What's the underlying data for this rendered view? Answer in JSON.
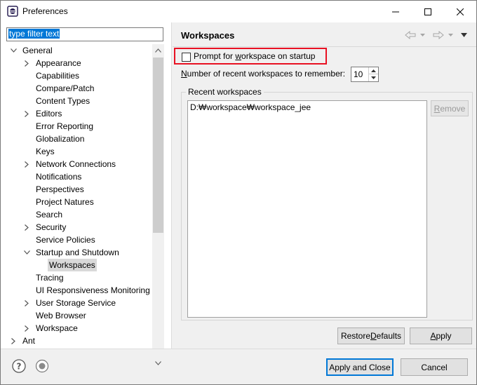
{
  "window": {
    "title": "Preferences"
  },
  "filter": {
    "value": "type filter text"
  },
  "tree": {
    "items": [
      {
        "label": "General",
        "level": 0,
        "expander": "expanded"
      },
      {
        "label": "Appearance",
        "level": 1,
        "expander": "collapsed"
      },
      {
        "label": "Capabilities",
        "level": 1,
        "expander": "none"
      },
      {
        "label": "Compare/Patch",
        "level": 1,
        "expander": "none"
      },
      {
        "label": "Content Types",
        "level": 1,
        "expander": "none"
      },
      {
        "label": "Editors",
        "level": 1,
        "expander": "collapsed"
      },
      {
        "label": "Error Reporting",
        "level": 1,
        "expander": "none"
      },
      {
        "label": "Globalization",
        "level": 1,
        "expander": "none"
      },
      {
        "label": "Keys",
        "level": 1,
        "expander": "none"
      },
      {
        "label": "Network Connections",
        "level": 1,
        "expander": "collapsed"
      },
      {
        "label": "Notifications",
        "level": 1,
        "expander": "none"
      },
      {
        "label": "Perspectives",
        "level": 1,
        "expander": "none"
      },
      {
        "label": "Project Natures",
        "level": 1,
        "expander": "none"
      },
      {
        "label": "Search",
        "level": 1,
        "expander": "none"
      },
      {
        "label": "Security",
        "level": 1,
        "expander": "collapsed"
      },
      {
        "label": "Service Policies",
        "level": 1,
        "expander": "none"
      },
      {
        "label": "Startup and Shutdown",
        "level": 1,
        "expander": "expanded"
      },
      {
        "label": "Workspaces",
        "level": 2,
        "expander": "none",
        "selected": true
      },
      {
        "label": "Tracing",
        "level": 1,
        "expander": "none"
      },
      {
        "label": "UI Responsiveness Monitoring",
        "level": 1,
        "expander": "none"
      },
      {
        "label": "User Storage Service",
        "level": 1,
        "expander": "collapsed"
      },
      {
        "label": "Web Browser",
        "level": 1,
        "expander": "none"
      },
      {
        "label": "Workspace",
        "level": 1,
        "expander": "collapsed"
      },
      {
        "label": "Ant",
        "level": 0,
        "expander": "collapsed"
      }
    ]
  },
  "page": {
    "title": "Workspaces",
    "prompt_checkbox": {
      "before": "Prompt for ",
      "mnemonic": "w",
      "after": "orkspace on startup",
      "checked": false
    },
    "recent_count": {
      "mnemonic": "N",
      "after": "umber of recent workspaces to remember:",
      "value": "10"
    },
    "recent_group": {
      "title": "Recent workspaces",
      "items": [
        "D:₩workspace₩workspace_jee"
      ]
    },
    "remove_button": {
      "mnemonic": "R",
      "after": "emove"
    },
    "restore_button": {
      "before": "Restore ",
      "mnemonic": "D",
      "after": "efaults"
    },
    "apply_button": {
      "mnemonic": "A",
      "after": "pply"
    }
  },
  "footer": {
    "apply_close_label": "Apply and Close",
    "cancel_label": "Cancel"
  },
  "colors": {
    "highlight_border": "#e81123",
    "selection": "#0078d7"
  }
}
